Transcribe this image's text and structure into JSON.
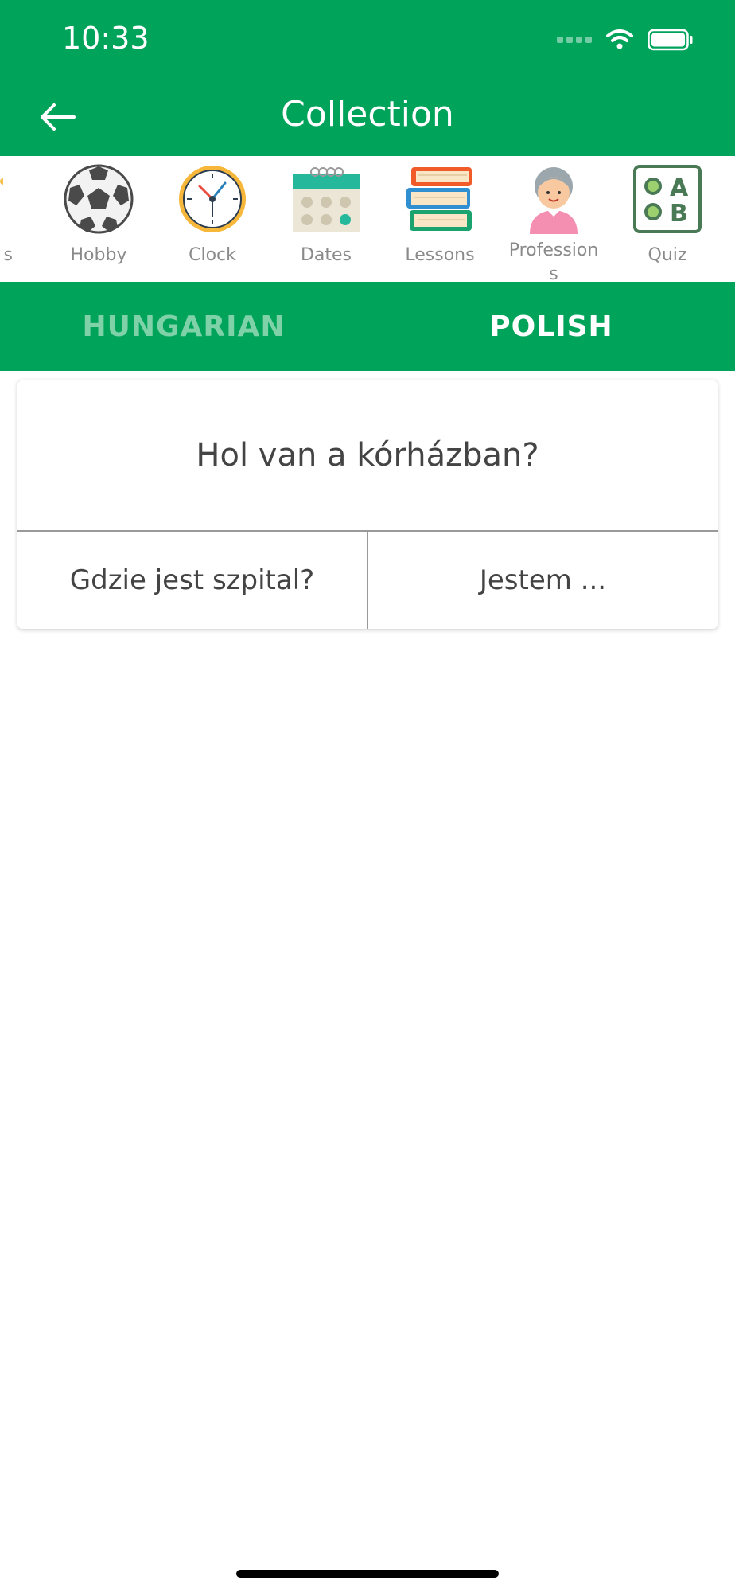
{
  "status_bar": {
    "time": "10:33"
  },
  "app_bar": {
    "title": "Collection"
  },
  "categories": {
    "items": [
      {
        "label": "s",
        "icon": "numbers-icon"
      },
      {
        "label": "Hobby",
        "icon": "soccer-ball-icon"
      },
      {
        "label": "Clock",
        "icon": "clock-icon"
      },
      {
        "label": "Dates",
        "icon": "calendar-icon"
      },
      {
        "label": "Lessons",
        "icon": "books-icon"
      },
      {
        "label": "Profession\ns",
        "icon": "profession-person-icon"
      },
      {
        "label": "Quiz",
        "icon": "quiz-icon"
      }
    ]
  },
  "language_tabs": {
    "left": "HUNGARIAN",
    "right": "POLISH",
    "selected": "POLISH"
  },
  "quiz_card": {
    "question": "Hol van a kórházban?",
    "options": [
      "Gdzie jest szpital?",
      "Jestem ..."
    ]
  },
  "colors": {
    "primary": "#00a35a",
    "tab_inactive": "#7fd2a8"
  }
}
